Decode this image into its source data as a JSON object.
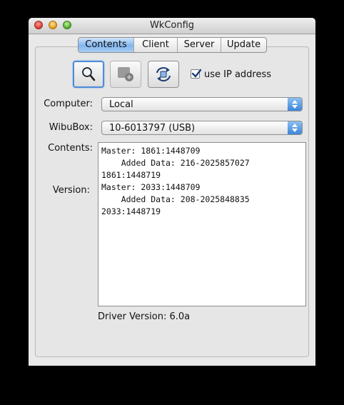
{
  "window": {
    "title": "WkConfig"
  },
  "tabs": [
    {
      "label": "Contents",
      "active": true
    },
    {
      "label": "Client",
      "active": false
    },
    {
      "label": "Server",
      "active": false
    },
    {
      "label": "Update",
      "active": false
    }
  ],
  "toolbar": {
    "buttons": [
      {
        "icon": "magnifier-icon",
        "state": "selected"
      },
      {
        "icon": "add-box-icon",
        "state": "disabled"
      },
      {
        "icon": "refresh-icon",
        "state": "normal"
      }
    ],
    "use_ip": {
      "label": "use IP address",
      "checked": true
    }
  },
  "form": {
    "computer_label": "Computer:",
    "computer_value": "Local",
    "wibubox_label": "WibuBox:",
    "wibubox_value": "10-6013797 (USB)",
    "contents_label": "Contents:",
    "version_label": "Version:"
  },
  "contents_text": [
    "Master: 1861:1448709",
    "    Added Data: 216-2025857027",
    "1861:1448719",
    "Master: 2033:1448709",
    "    Added Data: 208-2025848835",
    "2033:1448719"
  ],
  "driver": {
    "label": "Driver Version:",
    "value": "6.0a"
  },
  "colors": {
    "accent": "#4d8bd8",
    "tab_active": "#82b5ee",
    "window_bg": "#e9e9e9"
  }
}
